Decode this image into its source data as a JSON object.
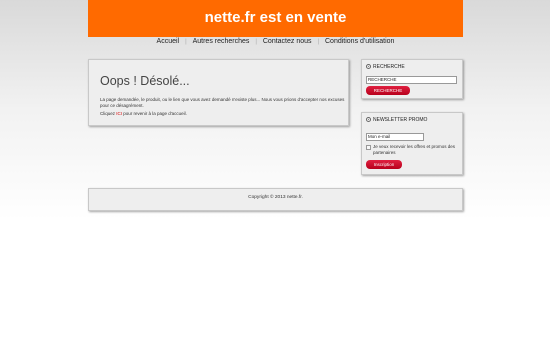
{
  "header": {
    "title": "nette.fr est en vente",
    "bg_color": "#ff6a00"
  },
  "nav": {
    "items": [
      "Accueil",
      "Autres recherches",
      "Contactez nous",
      "Conditions d'utilisation"
    ],
    "separator": "|"
  },
  "main": {
    "title": "Oops ! Désolé...",
    "paragraph": "La page demandée, le produit, ou le lien que vous avez demandé n'existe plus... Nous vous prions d'accepter nos excuses pour ce désagrément.",
    "return_prefix": "Cliquez ",
    "return_link": "ICI",
    "return_suffix": " pour revenir à la page d'accueil."
  },
  "search": {
    "heading": "RECHERCHE",
    "input_value": "RECHERCHE",
    "button_label": "RECHERCHE"
  },
  "newsletter": {
    "heading": "NEWSLETTER PROMO",
    "email_value": "Mon e-mail",
    "checkbox_label": "Je veux recevoir les offres et promos des partenaires",
    "button_label": "Inscription"
  },
  "footer": {
    "copyright": "Copyright © 2013 nette.fr."
  },
  "colors": {
    "accent": "#ff6a00",
    "button": "#cc0022",
    "link": "#d40000"
  }
}
